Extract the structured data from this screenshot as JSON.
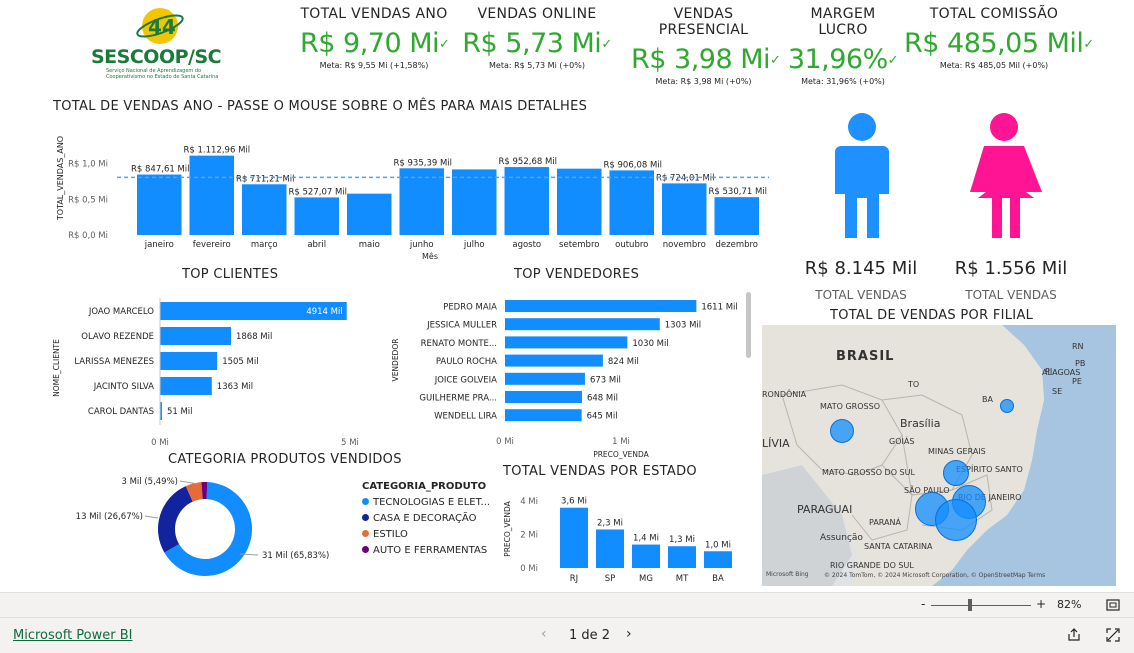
{
  "logo": {
    "text": "SESCOOP/SC",
    "subtitle1": "Serviço Nacional de Aprendizagem do",
    "subtitle2": "Cooperativismo no Estado de Santa Catarina",
    "icon": "coop-globe-logo"
  },
  "kpis": [
    {
      "title": "TOTAL VENDAS ANO",
      "value": "R$ 9,70 Mi",
      "meta": "Meta: R$ 9,55 Mi (+1,58%)"
    },
    {
      "title": "VENDAS ONLINE",
      "value": "R$ 5,73 Mi",
      "meta": "Meta: R$ 5,73 Mi (+0%)"
    },
    {
      "title": "VENDAS PRESENCIAL",
      "value": "R$ 3,98 Mi",
      "meta": "Meta: R$ 3,98 Mi (+0%)"
    },
    {
      "title": "MARGEM LUCRO",
      "value": "31,96%",
      "meta": "Meta: 31,96% (+0%)"
    },
    {
      "title": "TOTAL COMISSÃO",
      "value": "R$ 485,05 Mil",
      "meta": "Meta: R$ 485,05 Mil (+0%)"
    }
  ],
  "colors": {
    "bar": "#118dff",
    "kpi_green": "#2ea82e",
    "donut": [
      "#118dff",
      "#12239e",
      "#e66c37",
      "#6b007b"
    ],
    "male": "#1e90ff",
    "female": "#ff1493"
  },
  "monthly": {
    "title": "TOTAL DE VENDAS ANO - PASSE O MOUSE SOBRE O MÊS PARA MAIS DETALHES",
    "ylabel": "TOTAL_VENDAS_ANO",
    "xlabel": "Mês",
    "ticks": [
      "R$ 1,0 Mi",
      "R$ 0,5 Mi",
      "R$ 0,0 Mi"
    ]
  },
  "gender": [
    {
      "value": "R$ 8.145 Mil",
      "label": "TOTAL VENDAS",
      "icon": "male-icon"
    },
    {
      "value": "R$ 1.556 Mil",
      "label": "TOTAL VENDAS",
      "icon": "female-icon"
    }
  ],
  "clients": {
    "title": "TOP CLIENTES",
    "ylabel": "NOME_CLIENTE",
    "axis": [
      "0 Mi",
      "5 Mi"
    ]
  },
  "sellers": {
    "title": "TOP VENDEDORES",
    "ylabel": "VENDEDOR",
    "xlabel": "PRECO_VENDA",
    "axis": [
      "0 Mi",
      "1 Mi"
    ]
  },
  "categories": {
    "title": "CATEGORIA PRODUTOS VENDIDOS",
    "legend_title": "CATEGORIA_PRODUTO"
  },
  "states": {
    "title": "TOTAL VENDAS POR ESTADO",
    "ylabel": "PRECO_VENDA",
    "ticks": [
      "4 Mi",
      "2 Mi",
      "0 Mi"
    ]
  },
  "map": {
    "title": "TOTAL DE VENDAS POR FILIAL",
    "labels": [
      "BRASIL",
      "PI",
      "RN",
      "PB",
      "PE",
      "ALAGOAS",
      "SE",
      "TO",
      "RONDÔNIA",
      "MATO GROSSO",
      "Brasília",
      "BA",
      "GOIÁS",
      "LÍVIA",
      "MINAS GERAIS",
      "MATO GROSSO DO SUL",
      "ESPÍRITO SANTO",
      "SÃO PAULO",
      "RIO DE JANEIRO",
      "PARAGUAI",
      "PARANÁ",
      "Assunção",
      "SANTA CATARINA",
      "RIO GRANDE DO SUL"
    ],
    "attribution": "© 2024 TomTom, © 2024 Microsoft Corporation, © OpenStreetMap  Terms",
    "bing": "Microsoft Bing"
  },
  "zoom": {
    "minus": "-",
    "plus": "+",
    "value": "82%"
  },
  "footer": {
    "brand": "Microsoft Power BI",
    "page": "1 de 2"
  },
  "chart_data": [
    {
      "type": "bar",
      "title": "TOTAL DE VENDAS ANO - PASSE O MOUSE SOBRE O MÊS PARA MAIS DETALHES",
      "xlabel": "Mês",
      "ylabel": "TOTAL_VENDAS_ANO",
      "categories": [
        "janeiro",
        "fevereiro",
        "março",
        "abril",
        "maio",
        "junho",
        "julho",
        "agosto",
        "setembro",
        "outubro",
        "novembro",
        "dezembro"
      ],
      "values": [
        847.61,
        1112.96,
        711.21,
        527.07,
        580,
        935.39,
        920,
        952.68,
        930,
        906.08,
        724.01,
        530.71
      ],
      "data_labels": [
        "R$ 847,61 Mil",
        "R$ 1.112,96 Mil",
        "R$ 711,21 Mil",
        "R$ 527,07 Mil",
        "",
        "R$ 935,39 Mil",
        "",
        "R$ 952,68 Mil",
        "",
        "R$ 906,08 Mil",
        "R$ 724,01 Mil",
        "R$ 530,71 Mil"
      ],
      "reference_line": 808,
      "ylim": [
        0,
        1150
      ],
      "unit": "Mil"
    },
    {
      "type": "bar",
      "orientation": "horizontal",
      "title": "TOP CLIENTES",
      "ylabel": "NOME_CLIENTE",
      "categories": [
        "JOAO MARCELO",
        "OLAVO REZENDE",
        "LARISSA MENEZES",
        "JACINTO SILVA",
        "CAROL DANTAS"
      ],
      "values": [
        4914,
        1868,
        1505,
        1363,
        51
      ],
      "data_labels": [
        "4914 Mil",
        "1868 Mil",
        "1505 Mil",
        "1363 Mil",
        "51 Mil"
      ],
      "xlim": [
        0,
        5000
      ]
    },
    {
      "type": "bar",
      "orientation": "horizontal",
      "title": "TOP VENDEDORES",
      "ylabel": "VENDEDOR",
      "xlabel": "PRECO_VENDA",
      "categories": [
        "PEDRO MAIA",
        "JESSICA MULLER",
        "RENATO MONTE...",
        "PAULO ROCHA",
        "JOICE GOLVEIA",
        "GUILHERME PRA...",
        "WENDELL LIRA"
      ],
      "values": [
        1611,
        1303,
        1030,
        824,
        673,
        648,
        645
      ],
      "data_labels": [
        "1611 Mil",
        "1303 Mil",
        "1030 Mil",
        "824 Mil",
        "673 Mil",
        "648 Mil",
        "645 Mil"
      ],
      "xlim": [
        0,
        1700
      ]
    },
    {
      "type": "pie",
      "donut": true,
      "title": "CATEGORIA PRODUTOS VENDIDOS",
      "legend_title": "CATEGORIA_PRODUTO",
      "categories": [
        "TECNOLOGIAS E ELET...",
        "CASA E DECORAÇÃO",
        "ESTILO",
        "AUTO E FERRAMENTAS"
      ],
      "values": [
        65.83,
        26.67,
        5.49,
        2.01
      ],
      "data_labels": [
        "31 Mil (65,83%)",
        "13 Mil (26,67%)",
        "3 Mil (5,49%)",
        ""
      ]
    },
    {
      "type": "bar",
      "title": "TOTAL VENDAS POR ESTADO",
      "ylabel": "PRECO_VENDA",
      "categories": [
        "RJ",
        "SP",
        "MG",
        "MT",
        "BA"
      ],
      "values": [
        3.6,
        2.3,
        1.4,
        1.3,
        1.0
      ],
      "data_labels": [
        "3,6 Mi",
        "2,3 Mi",
        "1,4 Mi",
        "1,3 Mi",
        "1,0 Mi"
      ],
      "ylim": [
        0,
        4
      ]
    }
  ]
}
